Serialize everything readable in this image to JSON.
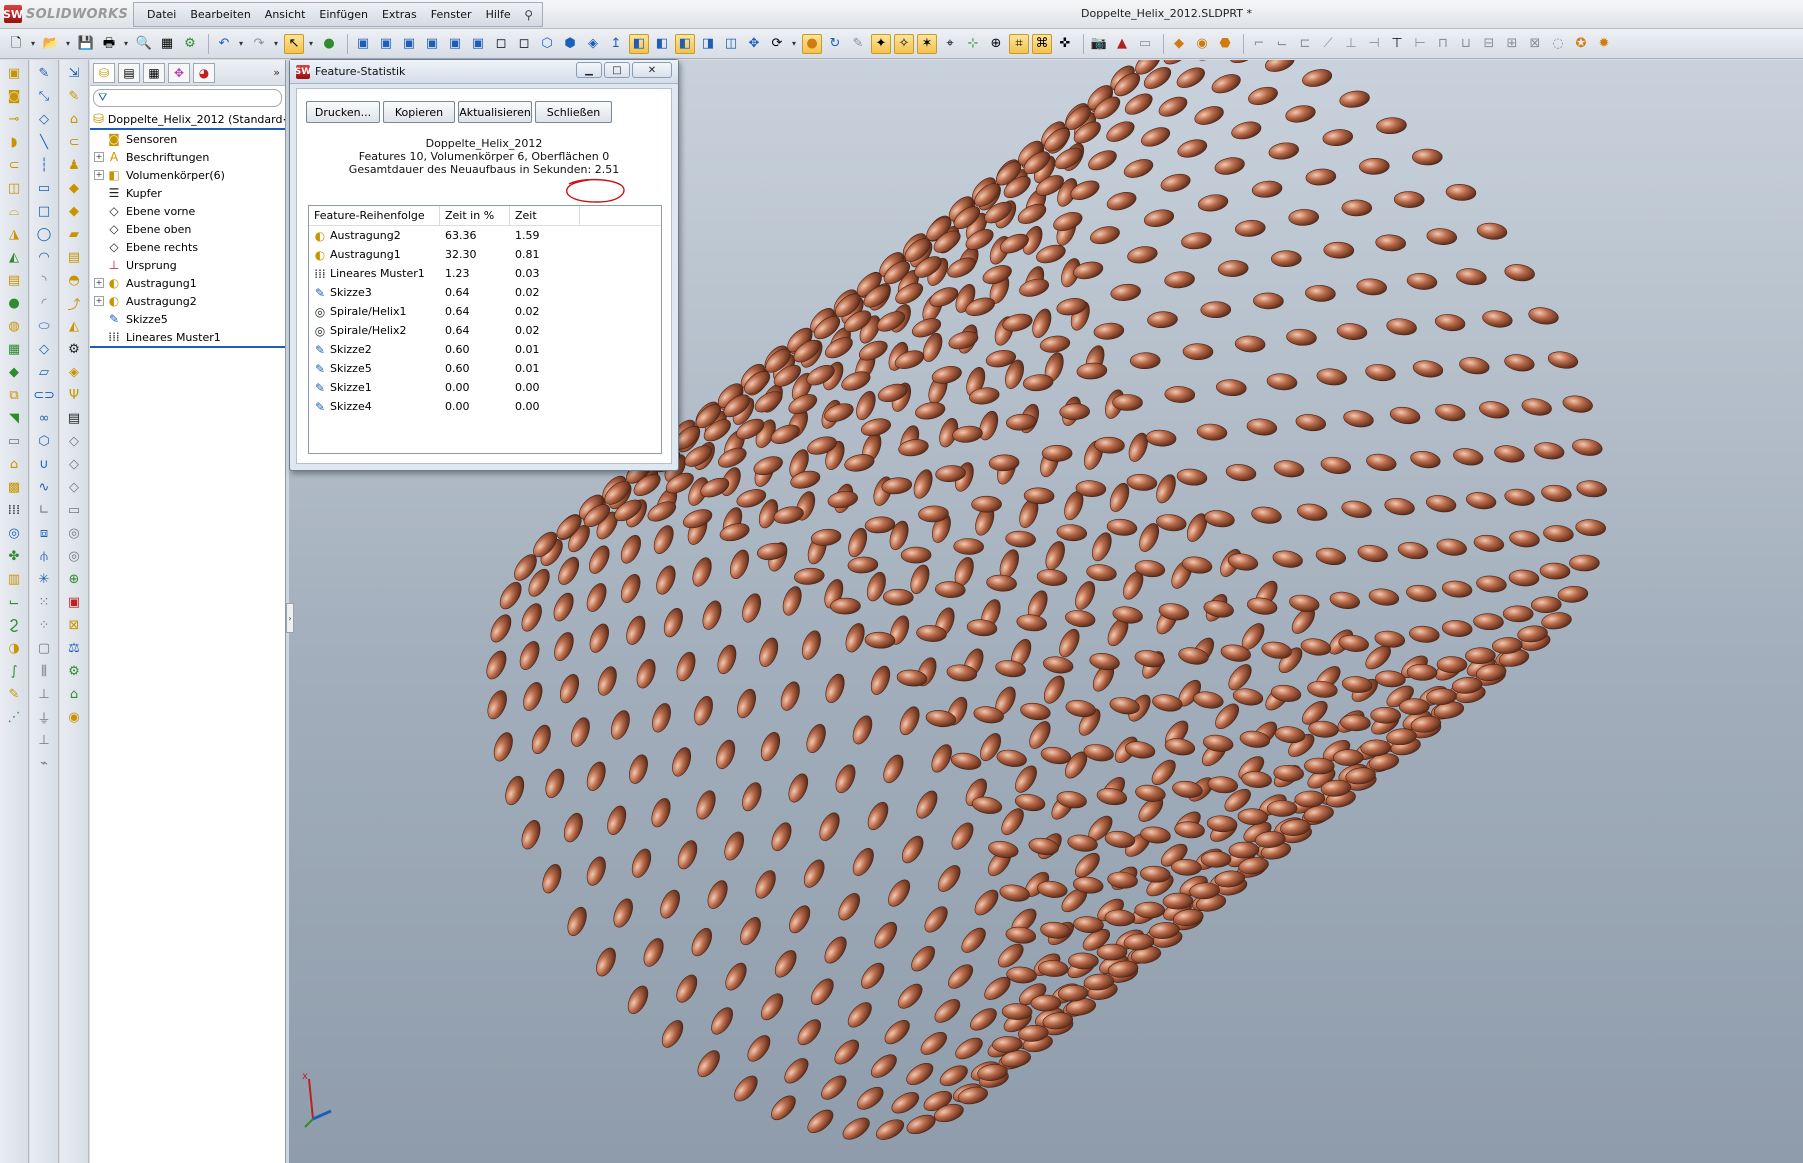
{
  "app": {
    "logo_text": "SOLIDWORKS",
    "logo_mark": "SW",
    "document_title": "Doppelte_Helix_2012.SLDPRT *"
  },
  "menu": [
    "Datei",
    "Bearbeiten",
    "Ansicht",
    "Einfügen",
    "Extras",
    "Fenster",
    "Hilfe"
  ],
  "featuremanager": {
    "filter_icon": "funnel-icon",
    "root_label": "Doppelte_Helix_2012  (Standard<<",
    "items": [
      {
        "label": "Sensoren",
        "icon": "sensor-folder-icon",
        "expandable": false
      },
      {
        "label": "Beschriftungen",
        "icon": "annotations-icon",
        "expandable": true
      },
      {
        "label": "Volumenkörper(6)",
        "icon": "solid-bodies-icon",
        "expandable": true
      },
      {
        "label": "Kupfer",
        "icon": "material-icon",
        "expandable": false
      },
      {
        "label": "Ebene vorne",
        "icon": "plane-icon",
        "expandable": false
      },
      {
        "label": "Ebene oben",
        "icon": "plane-icon",
        "expandable": false
      },
      {
        "label": "Ebene rechts",
        "icon": "plane-icon",
        "expandable": false
      },
      {
        "label": "Ursprung",
        "icon": "origin-icon",
        "expandable": false
      },
      {
        "label": "Austragung1",
        "icon": "sweep-icon",
        "expandable": true
      },
      {
        "label": "Austragung2",
        "icon": "sweep-icon",
        "expandable": true
      },
      {
        "label": "Skizze5",
        "icon": "sketch-icon",
        "expandable": false
      },
      {
        "label": "Lineares Muster1",
        "icon": "linear-pattern-icon",
        "expandable": false
      }
    ]
  },
  "dialog": {
    "title": "Feature-Statistik",
    "buttons": {
      "print": "Drucken...",
      "copy": "Kopieren",
      "update": "Aktualisieren",
      "close": "Schließen"
    },
    "summary": {
      "name": "Doppelte_Helix_2012",
      "counts": "Features 10, Volumenkörper 6, Oberflächen 0",
      "rebuild": "Gesamtdauer des Neuaufbaus in Sekunden: 2.51"
    },
    "columns": [
      "Feature-Reihenfolge",
      "Zeit in %",
      "Zeit"
    ],
    "rows": [
      {
        "name": "Austragung2",
        "pct": "63.36",
        "time": "1.59",
        "icon": "sweep-icon"
      },
      {
        "name": "Austragung1",
        "pct": "32.30",
        "time": "0.81",
        "icon": "sweep-icon"
      },
      {
        "name": "Lineares Muster1",
        "pct": "1.23",
        "time": "0.03",
        "icon": "linear-pattern-icon"
      },
      {
        "name": "Skizze3",
        "pct": "0.64",
        "time": "0.02",
        "icon": "sketch-icon"
      },
      {
        "name": "Spirale/Helix1",
        "pct": "0.64",
        "time": "0.02",
        "icon": "helix-icon"
      },
      {
        "name": "Spirale/Helix2",
        "pct": "0.64",
        "time": "0.02",
        "icon": "helix-icon"
      },
      {
        "name": "Skizze2",
        "pct": "0.60",
        "time": "0.01",
        "icon": "sketch-icon"
      },
      {
        "name": "Skizze5",
        "pct": "0.60",
        "time": "0.01",
        "icon": "sketch-icon"
      },
      {
        "name": "Skizze1",
        "pct": "0.00",
        "time": "0.00",
        "icon": "sketch-icon"
      },
      {
        "name": "Skizze4",
        "pct": "0.00",
        "time": "0.00",
        "icon": "sketch-icon"
      }
    ]
  },
  "colors": {
    "copper": "#b86a4a",
    "viewport_top": "#c9d2dc",
    "viewport_bottom": "#8f9cab",
    "accent": "#1d5fb8",
    "annotation_red": "#d01010"
  },
  "triad": {
    "x_label": "x"
  }
}
